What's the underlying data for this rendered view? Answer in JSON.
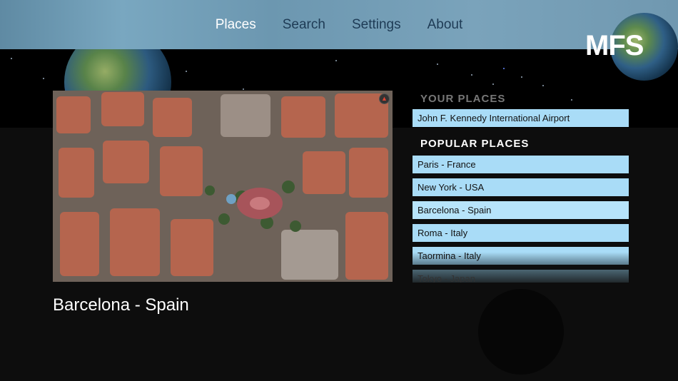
{
  "nav": {
    "tabs": [
      {
        "label": "Places",
        "active": true
      },
      {
        "label": "Search",
        "active": false
      },
      {
        "label": "Settings",
        "active": false
      },
      {
        "label": "About",
        "active": false
      }
    ]
  },
  "logo": "MFS",
  "preview": {
    "title": "Barcelona - Spain"
  },
  "your_places": {
    "header": "YOUR PLACES",
    "items": [
      "John F. Kennedy International Airport"
    ]
  },
  "popular_places": {
    "header": "POPULAR PLACES",
    "items": [
      "Paris - France",
      "New York - USA",
      "Barcelona - Spain",
      "Roma - Italy",
      "Taormina - Italy",
      "Tokyo - Japan"
    ]
  },
  "colors": {
    "nav_bg": "#7aa3bb",
    "tab_inactive": "#1e3b55",
    "tab_active": "#ffffff",
    "list_item_bg": "#a9dcf7"
  }
}
